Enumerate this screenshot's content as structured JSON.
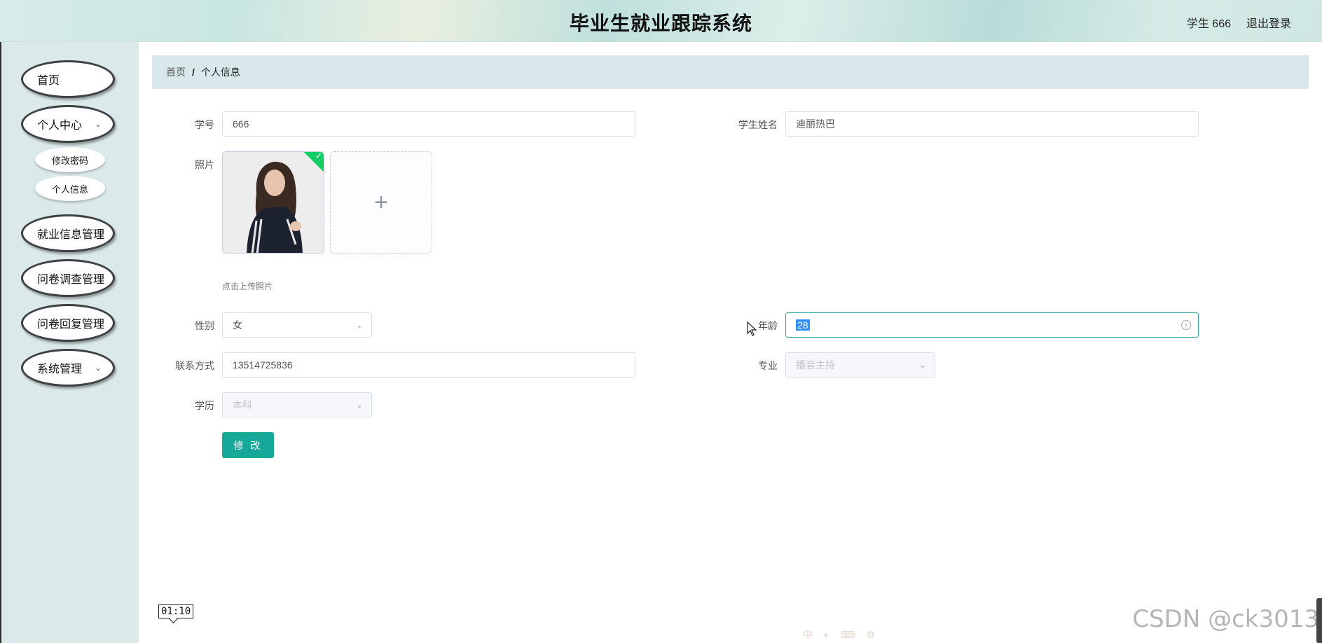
{
  "header": {
    "title": "毕业生就业跟踪系统",
    "user_label": "学生 666",
    "logout_label": "退出登录"
  },
  "sidebar": {
    "items": [
      {
        "label": "首页"
      },
      {
        "label": "个人中心",
        "icon": "chevron-down-icon"
      },
      {
        "label": "修改密码"
      },
      {
        "label": "个人信息"
      },
      {
        "label": "就业信息管理"
      },
      {
        "label": "问卷调查管理"
      },
      {
        "label": "问卷回复管理"
      },
      {
        "label": "系统管理",
        "icon": "chevron-down-icon"
      }
    ]
  },
  "breadcrumb": {
    "home": "首页",
    "separator": "/",
    "current": "个人信息"
  },
  "form": {
    "student_id": {
      "label": "学号",
      "value": "666"
    },
    "student_name": {
      "label": "学生姓名",
      "value": "迪丽热巴"
    },
    "photo": {
      "label": "照片",
      "upload_hint": "点击上传照片",
      "plus": "+"
    },
    "gender": {
      "label": "性别",
      "value": "女"
    },
    "age": {
      "label": "年龄",
      "value": "28"
    },
    "phone": {
      "label": "联系方式",
      "value": "13514725836"
    },
    "major": {
      "label": "专业",
      "value": "播音主持"
    },
    "education": {
      "label": "学历",
      "value": "本科"
    },
    "submit_label": "修 改"
  },
  "overlay": {
    "timer": "01:10",
    "watermark": "CSDN @ck3013",
    "ime_toolbar": "中 ◐ ⌨ ⚙"
  },
  "colors": {
    "accent": "#16a99a",
    "sidebar_bg": "#dbe9ea",
    "breadcrumb_bg": "#d9e8ea"
  }
}
